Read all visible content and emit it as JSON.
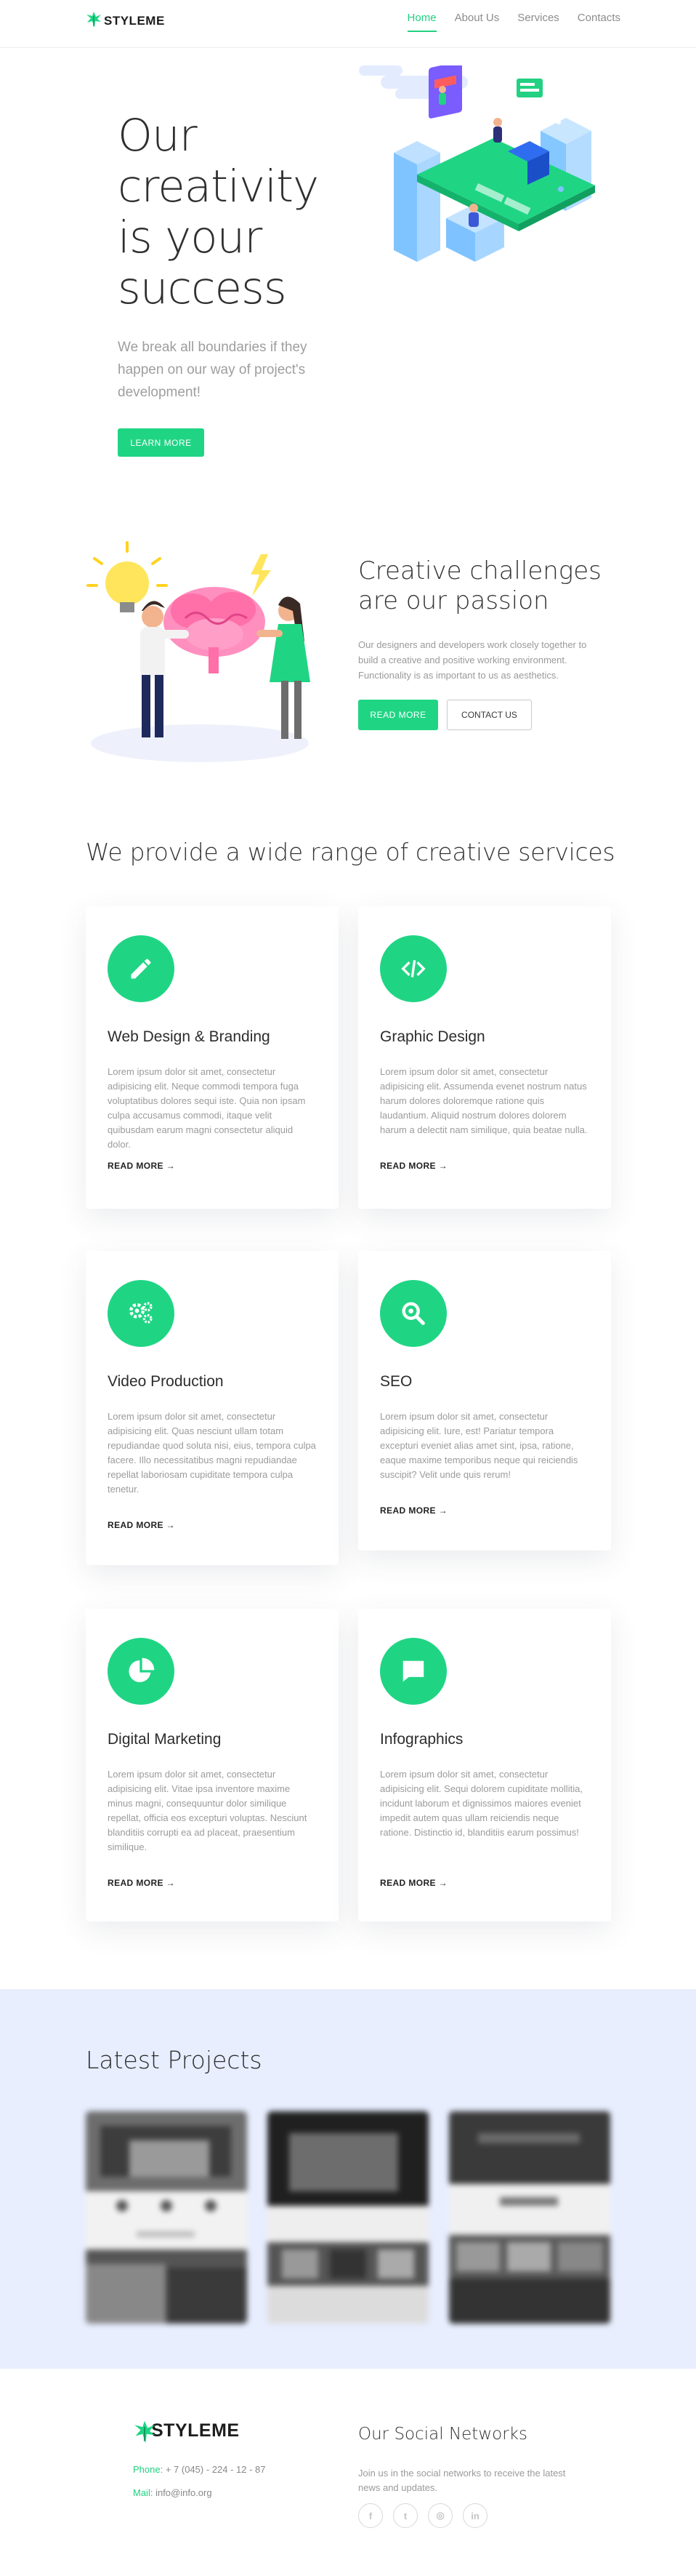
{
  "brand": {
    "name": "STYLEME",
    "accent": "#1fd584"
  },
  "nav": {
    "items": [
      "Home",
      "About Us",
      "Services",
      "Contacts"
    ],
    "active": "Home"
  },
  "hero": {
    "title": "Our creativity is your success",
    "subtitle": "We break all boundaries if they happen on our way of project's development!",
    "button": "LEARN MORE"
  },
  "challenges": {
    "title": "Creative challenges are our passion",
    "text": "Our designers and developers work closely together to build a creative and positive working environment. Functionality is as important to us as aesthetics.",
    "button_primary": "READ MORE",
    "button_secondary": "CONTACT US"
  },
  "services": {
    "heading": "We provide a wide range of creative services",
    "read_more": "READ MORE →",
    "items": [
      {
        "icon": "pencil-icon",
        "title": "Web Design & Branding",
        "text": "Lorem ipsum dolor sit amet, consectetur adipisicing elit. Neque commodi tempora fuga voluptatibus dolores sequi iste. Quia non ipsam culpa accusamus commodi, itaque velit quibusdam earum magni consectetur aliquid dolor."
      },
      {
        "icon": "code-icon",
        "title": "Graphic Design",
        "text": "Lorem ipsum dolor sit amet, consectetur adipisicing elit. Assumenda evenet nostrum natus harum dolores doloremque ratione quis laudantium. Aliquid nostrum dolores dolorem harum a delectit nam similique, quia beatae nulla."
      },
      {
        "icon": "gears-icon",
        "title": "Video Production",
        "text": "Lorem ipsum dolor sit amet, consectetur adipisicing elit. Quas nesciunt ullam totam repudiandae quod soluta nisi, eius, tempora culpa facere. Illo necessitatibus magni repudiandae repellat laboriosam cupiditate tempora culpa tenetur."
      },
      {
        "icon": "search-icon",
        "title": "SEO",
        "text": "Lorem ipsum dolor sit amet, consectetur adipisicing elit. Iure, est! Pariatur tempora excepturi eveniet alias amet sint, ipsa, ratione, eaque maxime temporibus neque qui reiciendis suscipit? Velit unde quis rerum!"
      },
      {
        "icon": "pie-chart-icon",
        "title": "Digital Marketing",
        "text": "Lorem ipsum dolor sit amet, consectetur adipisicing elit. Vitae ipsa inventore maxime minus magni, consequuntur dolor similique repellat, officia eos excepturi voluptas. Nesciunt blanditiis corrupti ea ad placeat, praesentium similique."
      },
      {
        "icon": "speech-bubble-icon",
        "title": "Infographics",
        "text": "Lorem ipsum dolor sit amet, consectetur adipisicing elit. Sequi dolorem cupiditate mollitia, incidunt laborum et dignissimos maiores eveniet impedit autem quas ullam reiciendis neque ratione. Distinctio id, blanditiis earum possimus!"
      }
    ]
  },
  "projects": {
    "heading": "Latest Projects"
  },
  "footer": {
    "logo": "STYLEME",
    "phone_label": "Phone:",
    "phone": "+ 7 (045) - 224 - 12 - 87",
    "mail_label": "Mail:",
    "mail": "info@info.org",
    "social_title": "Our Social Networks",
    "social_text": "Join us in the social networks to receive the latest news and updates.",
    "social_icons": [
      {
        "name": "facebook-icon",
        "glyph": "f"
      },
      {
        "name": "twitter-icon",
        "glyph": "t"
      },
      {
        "name": "instagram-icon",
        "glyph": "◎"
      },
      {
        "name": "linkedin-icon",
        "glyph": "in"
      }
    ]
  }
}
